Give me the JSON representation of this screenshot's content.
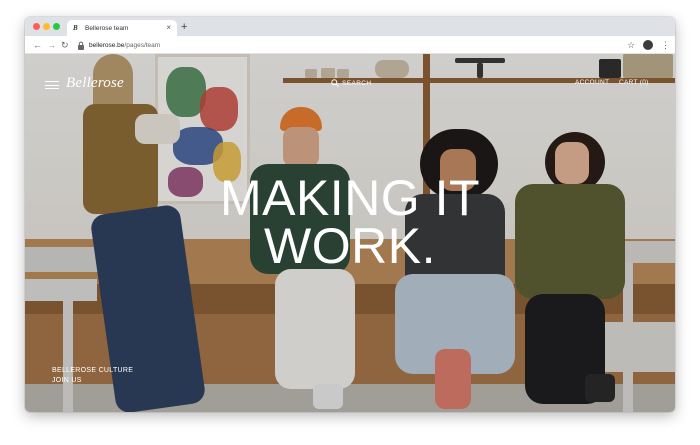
{
  "browser": {
    "tab_title": "Bellerose team",
    "tab_favicon": "B",
    "tab_close": "×",
    "new_tab": "+",
    "url_domain": "bellerose.be",
    "url_path": "/pages/team",
    "icons": {
      "back": "back-arrow-icon",
      "forward": "forward-arrow-icon",
      "reload": "reload-icon",
      "lock": "lock-icon",
      "bookmark": "star-icon",
      "profile": "profile-icon",
      "menu": "kebab-menu-icon"
    }
  },
  "site": {
    "logo": "Bellerose",
    "search_label": "SEARCH",
    "account_label": "ACCOUNT",
    "cart_label": "CART (0)",
    "headline_line1": "MAKING IT",
    "headline_line2": "WORK.",
    "footer_link_1": "BELLEROSE CULTURE",
    "footer_link_2": "JOIN US"
  },
  "colors": {
    "overlay_text": "#ffffff",
    "tab_strip": "#dee1e6",
    "bench_wood": "#a27448"
  }
}
